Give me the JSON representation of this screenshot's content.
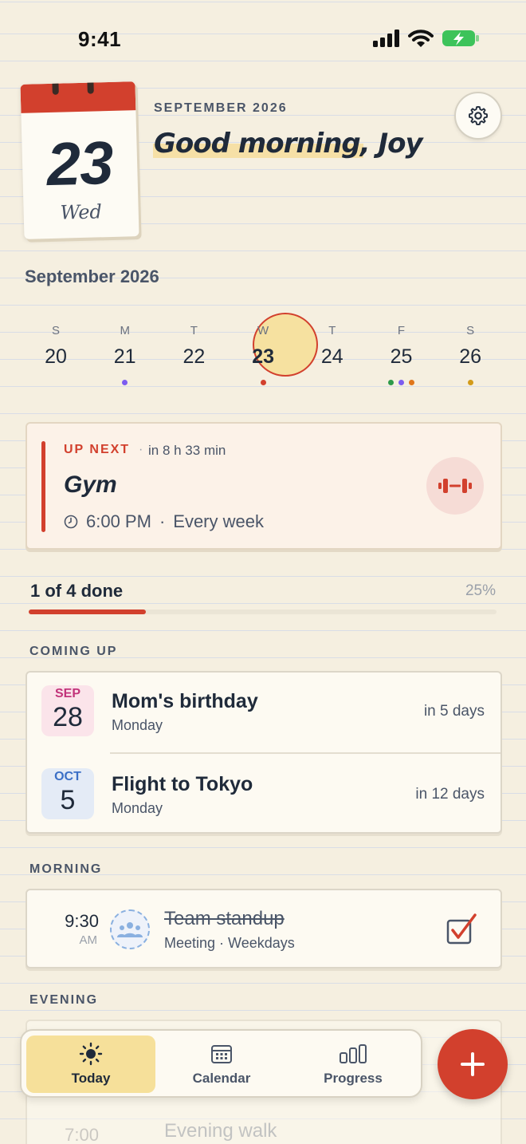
{
  "status_bar": {
    "time": "9:41"
  },
  "header": {
    "date_card": {
      "day_number": "23",
      "weekday": "Wed"
    },
    "month_label": "SEPTEMBER 2026",
    "greeting": "Good morning, Joy"
  },
  "calendar": {
    "month_title": "September 2026",
    "days": [
      {
        "letter": "S",
        "num": "20",
        "dots": []
      },
      {
        "letter": "M",
        "num": "21",
        "dots": [
          "#7c5cf0"
        ]
      },
      {
        "letter": "T",
        "num": "22",
        "dots": []
      },
      {
        "letter": "W",
        "num": "23",
        "dots": [
          "#d2402d"
        ],
        "today": true
      },
      {
        "letter": "T",
        "num": "24",
        "dots": []
      },
      {
        "letter": "F",
        "num": "25",
        "dots": [
          "#2e9a4a",
          "#7c5cf0",
          "#e0761a"
        ]
      },
      {
        "letter": "S",
        "num": "26",
        "dots": [
          "#d39b1a"
        ]
      }
    ]
  },
  "up_next": {
    "label": "UP NEXT",
    "separator": "·",
    "countdown": "in 8 h 33 min",
    "title": "Gym",
    "time": "6:00 PM",
    "time_separator": "·",
    "repeat": "Every week",
    "icon": "dumbbell-icon"
  },
  "progress": {
    "label": "1 of 4 done",
    "percent_label": "25%",
    "fraction": 0.25
  },
  "coming_up": {
    "title": "COMING UP",
    "items": [
      {
        "month": "SEP",
        "day": "28",
        "title": "Mom's birthday",
        "weekday": "Monday",
        "when": "in 5 days",
        "chip_bg": "#fbe4ea",
        "month_color": "#c2337a"
      },
      {
        "month": "OCT",
        "day": "5",
        "title": "Flight to Tokyo",
        "weekday": "Monday",
        "when": "in 12 days",
        "chip_bg": "#e4ebf6",
        "month_color": "#3b6fc6"
      }
    ]
  },
  "morning": {
    "title": "MORNING",
    "task": {
      "time": "9:30",
      "ampm": "AM",
      "title": "Team standup",
      "subtitle": "Meeting · Weekdays",
      "done": true,
      "icon": "people-icon"
    }
  },
  "evening": {
    "title": "EVENING",
    "task": {
      "time": "7:00",
      "title": "Evening walk",
      "icon": "walk-icon"
    }
  },
  "tabs": [
    {
      "label": "Today",
      "icon": "sun-icon",
      "active": true
    },
    {
      "label": "Calendar",
      "icon": "calendar-icon",
      "active": false
    },
    {
      "label": "Progress",
      "icon": "bar-chart-icon",
      "active": false
    }
  ],
  "colors": {
    "accent": "#d2402d",
    "highlight": "#f6e09a",
    "paper": "#f5efe0"
  }
}
